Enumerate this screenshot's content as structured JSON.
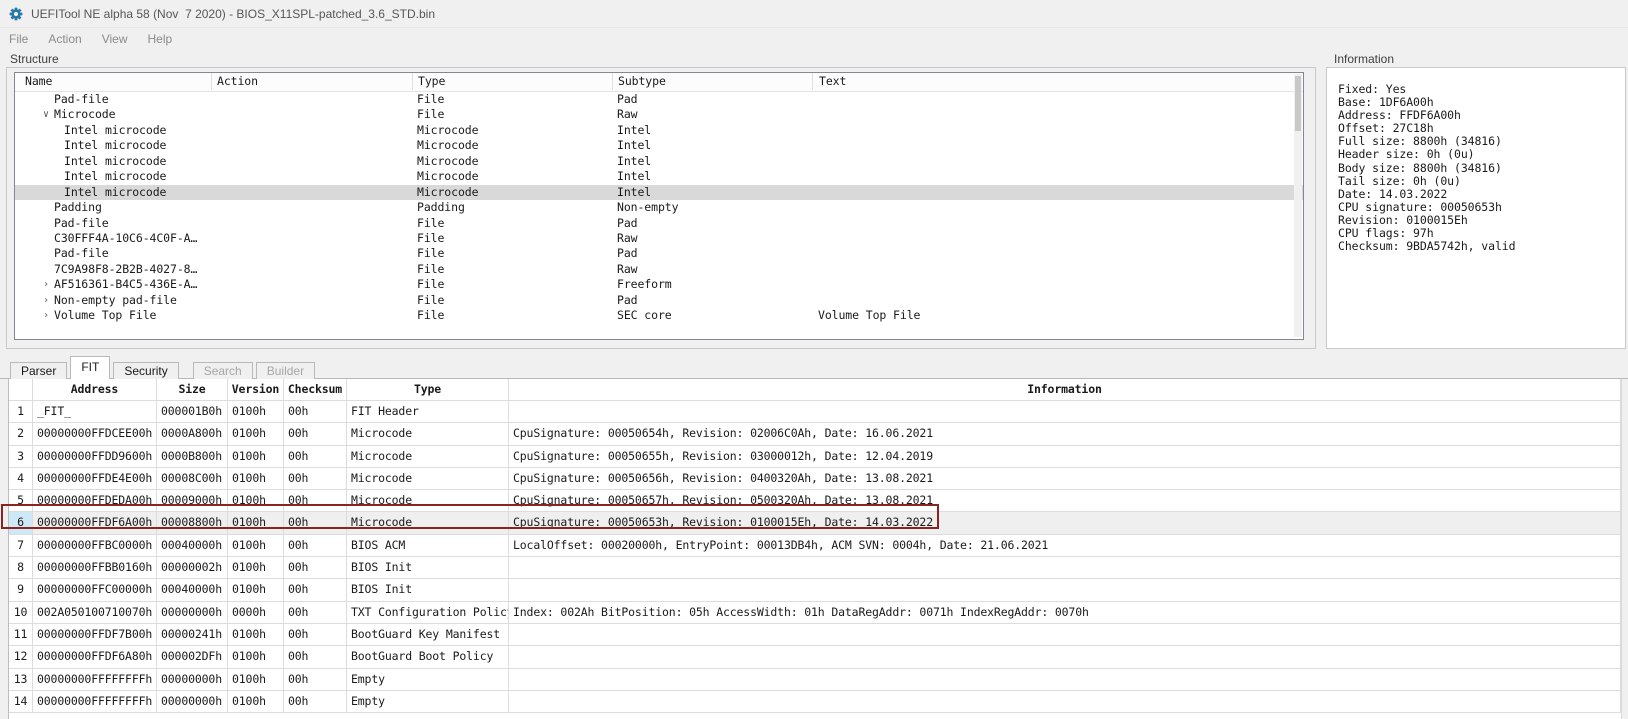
{
  "window": {
    "title": "UEFITool NE alpha 58 (Nov  7 2020) - BIOS_X11SPL-patched_3.6_STD.bin",
    "menu": [
      "File",
      "Action",
      "View",
      "Help"
    ]
  },
  "structure": {
    "label": "Structure",
    "columns": [
      "Name",
      "Action",
      "Type",
      "Subtype",
      "Text"
    ],
    "rows": [
      {
        "name": "Pad-file",
        "action": "",
        "type": "File",
        "subtype": "Pad",
        "text": "",
        "indent": 0,
        "arrow": "",
        "selected": false
      },
      {
        "name": "Microcode",
        "action": "",
        "type": "File",
        "subtype": "Raw",
        "text": "",
        "indent": 0,
        "arrow": "expanded",
        "selected": false
      },
      {
        "name": "Intel microcode",
        "action": "",
        "type": "Microcode",
        "subtype": "Intel",
        "text": "",
        "indent": 1,
        "arrow": "",
        "selected": false
      },
      {
        "name": "Intel microcode",
        "action": "",
        "type": "Microcode",
        "subtype": "Intel",
        "text": "",
        "indent": 1,
        "arrow": "",
        "selected": false
      },
      {
        "name": "Intel microcode",
        "action": "",
        "type": "Microcode",
        "subtype": "Intel",
        "text": "",
        "indent": 1,
        "arrow": "",
        "selected": false
      },
      {
        "name": "Intel microcode",
        "action": "",
        "type": "Microcode",
        "subtype": "Intel",
        "text": "",
        "indent": 1,
        "arrow": "",
        "selected": false
      },
      {
        "name": "Intel microcode",
        "action": "",
        "type": "Microcode",
        "subtype": "Intel",
        "text": "",
        "indent": 1,
        "arrow": "",
        "selected": true
      },
      {
        "name": "Padding",
        "action": "",
        "type": "Padding",
        "subtype": "Non-empty",
        "text": "",
        "indent": 0,
        "arrow": "",
        "selected": false
      },
      {
        "name": "Pad-file",
        "action": "",
        "type": "File",
        "subtype": "Pad",
        "text": "",
        "indent": 0,
        "arrow": "",
        "selected": false
      },
      {
        "name": "C30FFF4A-10C6-4C0F-A…",
        "action": "",
        "type": "File",
        "subtype": "Raw",
        "text": "",
        "indent": 0,
        "arrow": "",
        "selected": false
      },
      {
        "name": "Pad-file",
        "action": "",
        "type": "File",
        "subtype": "Pad",
        "text": "",
        "indent": 0,
        "arrow": "",
        "selected": false
      },
      {
        "name": "7C9A98F8-2B2B-4027-8…",
        "action": "",
        "type": "File",
        "subtype": "Raw",
        "text": "",
        "indent": 0,
        "arrow": "",
        "selected": false
      },
      {
        "name": "AF516361-B4C5-436E-A…",
        "action": "",
        "type": "File",
        "subtype": "Freeform",
        "text": "",
        "indent": 0,
        "arrow": "collapsed",
        "selected": false
      },
      {
        "name": "Non-empty pad-file",
        "action": "",
        "type": "File",
        "subtype": "Pad",
        "text": "",
        "indent": 0,
        "arrow": "collapsed",
        "selected": false
      },
      {
        "name": "Volume Top File",
        "action": "",
        "type": "File",
        "subtype": "SEC core",
        "text": "Volume Top File",
        "indent": 0,
        "arrow": "collapsed",
        "selected": false
      }
    ]
  },
  "information": {
    "label": "Information",
    "lines": [
      "Fixed: Yes",
      "Base: 1DF6A00h",
      "Address: FFDF6A00h",
      "Offset: 27C18h",
      "Full size: 8800h (34816)",
      "Header size: 0h (0u)",
      "Body size: 8800h (34816)",
      "Tail size: 0h (0u)",
      "Date: 14.03.2022",
      "CPU signature: 00050653h",
      "Revision: 0100015Eh",
      "CPU flags: 97h",
      "Checksum: 9BDA5742h, valid"
    ]
  },
  "tabs": [
    {
      "label": "Parser",
      "state": "normal"
    },
    {
      "label": "FIT",
      "state": "active"
    },
    {
      "label": "Security",
      "state": "normal"
    },
    {
      "label": "Search",
      "state": "disabled"
    },
    {
      "label": "Builder",
      "state": "disabled"
    }
  ],
  "fit": {
    "columns": [
      "",
      "Address",
      "Size",
      "Version",
      "Checksum",
      "Type",
      "Information"
    ],
    "rows": [
      {
        "num": "1",
        "address": "_FIT_",
        "size": "000001B0h",
        "version": "0100h",
        "checksum": "00h",
        "type": "FIT Header",
        "info": "",
        "highlighted": false
      },
      {
        "num": "2",
        "address": "00000000FFDCEE00h",
        "size": "0000A800h",
        "version": "0100h",
        "checksum": "00h",
        "type": "Microcode",
        "info": "CpuSignature: 00050654h, Revision: 02006C0Ah, Date: 16.06.2021",
        "highlighted": false
      },
      {
        "num": "3",
        "address": "00000000FFDD9600h",
        "size": "0000B800h",
        "version": "0100h",
        "checksum": "00h",
        "type": "Microcode",
        "info": "CpuSignature: 00050655h, Revision: 03000012h, Date: 12.04.2019",
        "highlighted": false
      },
      {
        "num": "4",
        "address": "00000000FFDE4E00h",
        "size": "00008C00h",
        "version": "0100h",
        "checksum": "00h",
        "type": "Microcode",
        "info": "CpuSignature: 00050656h, Revision: 0400320Ah, Date: 13.08.2021",
        "highlighted": false
      },
      {
        "num": "5",
        "address": "00000000FFDEDA00h",
        "size": "00009000h",
        "version": "0100h",
        "checksum": "00h",
        "type": "Microcode",
        "info": "CpuSignature: 00050657h, Revision: 0500320Ah, Date: 13.08.2021",
        "highlighted": false
      },
      {
        "num": "6",
        "address": "00000000FFDF6A00h",
        "size": "00008800h",
        "version": "0100h",
        "checksum": "00h",
        "type": "Microcode",
        "info": "CpuSignature: 00050653h, Revision: 0100015Eh, Date: 14.03.2022",
        "highlighted": true
      },
      {
        "num": "7",
        "address": "00000000FFBC0000h",
        "size": "00040000h",
        "version": "0100h",
        "checksum": "00h",
        "type": "BIOS ACM",
        "info": "LocalOffset: 00020000h, EntryPoint: 00013DB4h, ACM SVN: 0004h, Date: 21.06.2021",
        "highlighted": false
      },
      {
        "num": "8",
        "address": "00000000FFBB0160h",
        "size": "00000002h",
        "version": "0100h",
        "checksum": "00h",
        "type": "BIOS Init",
        "info": "",
        "highlighted": false
      },
      {
        "num": "9",
        "address": "00000000FFC00000h",
        "size": "00040000h",
        "version": "0100h",
        "checksum": "00h",
        "type": "BIOS Init",
        "info": "",
        "highlighted": false
      },
      {
        "num": "10",
        "address": "002A050100710070h",
        "size": "00000000h",
        "version": "0000h",
        "checksum": "00h",
        "type": "TXT Configuration Policy",
        "info": "Index: 002Ah BitPosition: 05h AccessWidth: 01h DataRegAddr: 0071h IndexRegAddr: 0070h",
        "highlighted": false
      },
      {
        "num": "11",
        "address": "00000000FFDF7B00h",
        "size": "00000241h",
        "version": "0100h",
        "checksum": "00h",
        "type": "BootGuard Key Manifest",
        "info": "",
        "highlighted": false
      },
      {
        "num": "12",
        "address": "00000000FFDF6A80h",
        "size": "000002DFh",
        "version": "0100h",
        "checksum": "00h",
        "type": "BootGuard Boot Policy",
        "info": "",
        "highlighted": false
      },
      {
        "num": "13",
        "address": "00000000FFFFFFFFh",
        "size": "00000000h",
        "version": "0100h",
        "checksum": "00h",
        "type": "Empty",
        "info": "",
        "highlighted": false
      },
      {
        "num": "14",
        "address": "00000000FFFFFFFFh",
        "size": "00000000h",
        "version": "0100h",
        "checksum": "00h",
        "type": "Empty",
        "info": "",
        "highlighted": false
      }
    ]
  },
  "icons": {
    "app": "uefitool-gear",
    "expanded_glyph": "∨",
    "collapsed_glyph": "›"
  },
  "colors": {
    "app_icon_blue": "#2879a8",
    "highlight_outline": "#8c2323",
    "tree_selection": "#d9d9d9",
    "row_number_selection": "#cde8f6"
  }
}
